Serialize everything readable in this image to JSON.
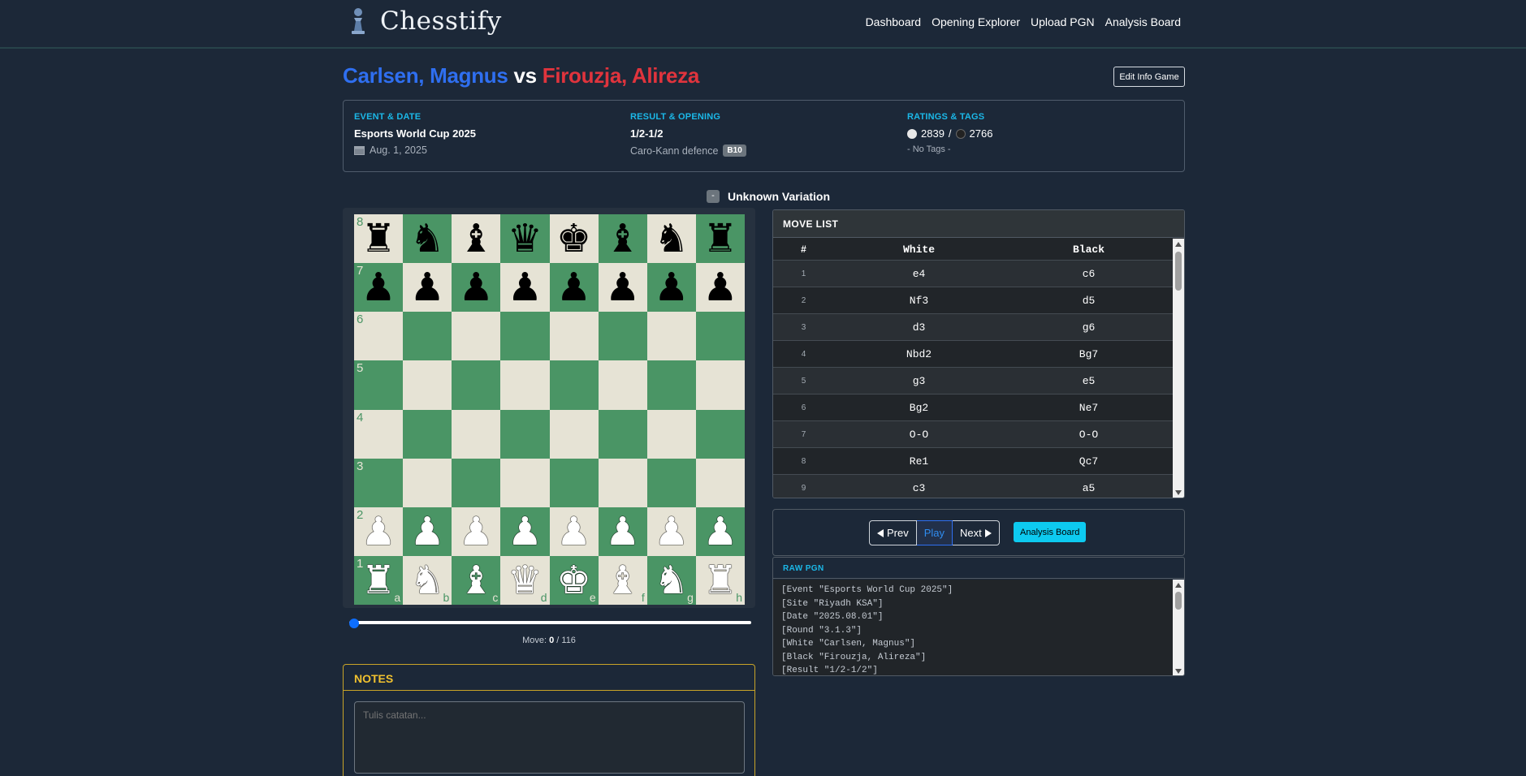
{
  "nav": {
    "brand": "Chesstify",
    "links": [
      "Dashboard",
      "Opening Explorer",
      "Upload PGN",
      "Analysis Board"
    ]
  },
  "game": {
    "white": "Carlsen, Magnus",
    "vs": " vs ",
    "black": "Firouzja, Alireza",
    "edit_label": "Edit Info Game"
  },
  "info": {
    "event_head": "EVENT & DATE",
    "event": "Esports World Cup 2025",
    "date": "Aug. 1, 2025",
    "result_head": "RESULT & OPENING",
    "result": "1/2-1/2",
    "opening": "Caro-Kann defence",
    "eco": "B10",
    "ratings_head": "RATINGS & TAGS",
    "white_rating": "2839",
    "rating_sep": " / ",
    "black_rating": "2766",
    "tags": "- No Tags -"
  },
  "variation": {
    "toggle": "-",
    "label": "Unknown Variation"
  },
  "board": {
    "files": [
      "a",
      "b",
      "c",
      "d",
      "e",
      "f",
      "g",
      "h"
    ],
    "ranks": [
      "8",
      "7",
      "6",
      "5",
      "4",
      "3",
      "2",
      "1"
    ],
    "position": [
      "rnbqkbnr",
      "pppppppp",
      "........",
      "........",
      "........",
      "........",
      "PPPPPPPP",
      "RNBQKBNR"
    ]
  },
  "progress": {
    "current": 0,
    "total": 116,
    "label": "Move:",
    "sep": " / "
  },
  "notes": {
    "title": "NOTES",
    "placeholder": "Tulis catatan..."
  },
  "move_list": {
    "title": "MOVE LIST",
    "columns": [
      "#",
      "White",
      "Black"
    ],
    "rows": [
      [
        "1",
        "e4",
        "c6"
      ],
      [
        "2",
        "Nf3",
        "d5"
      ],
      [
        "3",
        "d3",
        "g6"
      ],
      [
        "4",
        "Nbd2",
        "Bg7"
      ],
      [
        "5",
        "g3",
        "e5"
      ],
      [
        "6",
        "Bg2",
        "Ne7"
      ],
      [
        "7",
        "O-O",
        "O-O"
      ],
      [
        "8",
        "Re1",
        "Qc7"
      ],
      [
        "9",
        "c3",
        "a5"
      ]
    ]
  },
  "controls": {
    "prev": "Prev",
    "play": "Play",
    "next": "Next",
    "analysis": "Analysis Board"
  },
  "pgn": {
    "title": "RAW PGN",
    "lines": [
      "[Event \"Esports World Cup 2025\"]",
      "[Site \"Riyadh KSA\"]",
      "[Date \"2025.08.01\"]",
      "[Round \"3.1.3\"]",
      "[White \"Carlsen, Magnus\"]",
      "[Black \"Firouzja, Alireza\"]",
      "[Result \"1/2-1/2\"]"
    ]
  },
  "colors": {
    "accent": "#1bb8e8",
    "white_player": "#2f6ff0",
    "black_player": "#e0343d",
    "board_light": "#e6e3d5",
    "board_dark": "#4a9565",
    "notes_border": "#c8a428"
  }
}
